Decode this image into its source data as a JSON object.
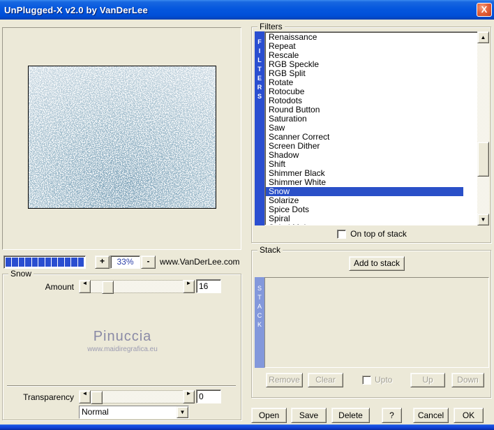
{
  "window": {
    "title": "UnPlugged-X v2.0 by VanDerLee",
    "close_label": "X"
  },
  "colors": {
    "dialog_bg": "#ECE9D8",
    "titlebar_blue": "#0553DE",
    "close_red": "#D8442A",
    "filters_bar_blue": "#2A4ED0",
    "selection_blue": "#2A50C8",
    "stack_bar_blue": "#8398DB",
    "zoom_value_blue": "#2B3FA8",
    "watermark_gray": "#8A8AA6"
  },
  "zoom_controls": {
    "progress_segments": 12,
    "zoom_in_label": "+",
    "zoom_value": "33%",
    "zoom_out_label": "-",
    "site_label": "www.VanDerLee.com"
  },
  "snow_group": {
    "label": "Snow",
    "amount": {
      "label": "Amount",
      "value": "16",
      "left_arrow": "◄",
      "right_arrow": "►"
    },
    "watermark": {
      "name": "Pinuccia",
      "site": "www.maidiregrafica.eu"
    },
    "transparency": {
      "label": "Transparency",
      "value": "0",
      "left_arrow": "◄",
      "right_arrow": "►"
    },
    "blend_mode": {
      "selected": "Normal",
      "arrow": "▼"
    }
  },
  "filters_group": {
    "label": "Filters",
    "vertical_label": "FILTERS",
    "items": [
      "Renaissance",
      "Repeat",
      "Rescale",
      "RGB Speckle",
      "RGB Split",
      "Rotate",
      "Rotocube",
      "Rotodots",
      "Round Button",
      "Saturation",
      "Saw",
      "Scanner Correct",
      "Screen Dither",
      "Shadow",
      "Shift",
      "Shimmer Black",
      "Shimmer White",
      "Snow",
      "Solarize",
      "Spice Dots",
      "Spiral",
      "Spiral Maker"
    ],
    "selected_index": 17,
    "scroll_up": "▲",
    "scroll_down": "▼",
    "on_top_checkbox_label": "On top of stack",
    "on_top_checked": false
  },
  "stack_group": {
    "label": "Stack",
    "vertical_label": "STACK",
    "add_button": "Add to stack",
    "remove_button": "Remove",
    "clear_button": "Clear",
    "upto_checkbox_label": "Upto",
    "upto_checked": false,
    "up_button": "Up",
    "down_button": "Down"
  },
  "bottom_buttons": {
    "open": "Open",
    "save": "Save",
    "delete": "Delete",
    "help": "?",
    "cancel": "Cancel",
    "ok": "OK"
  }
}
